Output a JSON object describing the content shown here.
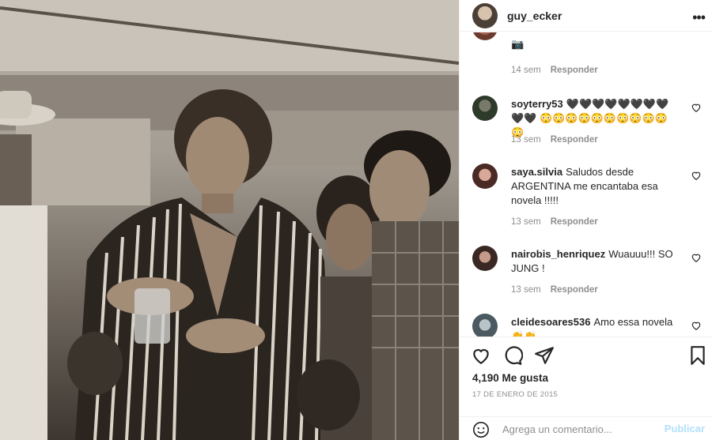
{
  "post": {
    "username": "guy_ecker",
    "likes": "4,190 Me gusta",
    "date": "17 DE ENERO DE 2015"
  },
  "comments": [
    {
      "username": "",
      "text": "",
      "emoji": "📷",
      "time": "14 sem",
      "reply": "Responder"
    },
    {
      "username": "soyterry53",
      "text": "🖤🖤🖤🖤🖤🖤🖤🖤🖤🖤 😳😳😳😳😳😳😳😳😳😳😳",
      "time": "13 sem",
      "reply": "Responder"
    },
    {
      "username": "saya.silvia",
      "text": "Saludos desde ARGENTINA me encantaba esa novela !!!!!",
      "time": "13 sem",
      "reply": "Responder"
    },
    {
      "username": "nairobis_henriquez",
      "text": "Wuauuu!!! SO JUNG !",
      "time": "13 sem",
      "reply": "Responder"
    },
    {
      "username": "cleidesoares536",
      "text": "Amo essa novela 👏👏",
      "time": "",
      "reply": ""
    }
  ],
  "add_comment": {
    "placeholder": "Agrega un comentario...",
    "publish_label": "Publicar"
  },
  "colors": {
    "publish_disabled": "#b2dffc",
    "meta_text": "#8e8e8e",
    "divider": "#efefef"
  },
  "icons": [
    "more-icon",
    "heart-icon",
    "comment-icon",
    "share-icon",
    "bookmark-icon",
    "emoji-icon"
  ]
}
